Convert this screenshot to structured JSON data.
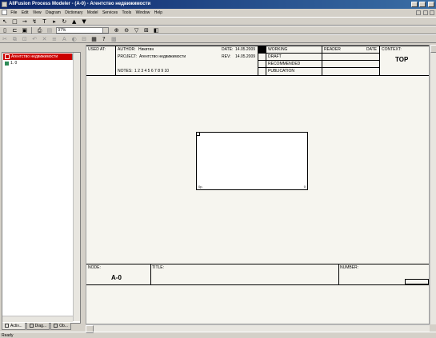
{
  "window": {
    "title": "AllFusion Process Modeler - (A-0) - Агентство недвижимости"
  },
  "menu": [
    "File",
    "Edit",
    "View",
    "Diagram",
    "Dictionary",
    "Model",
    "Services",
    "Tools",
    "Window",
    "Help"
  ],
  "toolbar": {
    "zoom_value": "97%"
  },
  "model_explorer": {
    "root_label": "Агентство недвижимости",
    "child_label": "1. 0",
    "tabs": [
      "Activ...",
      "Diag...",
      "Ob..."
    ]
  },
  "diagram": {
    "used_at_label": "USED AT:",
    "author_label": "AUTHOR:",
    "author_value": "Никитин",
    "date_label": "DATE:",
    "date_value": "14.05.2009",
    "project_label": "PROJECT:",
    "project_value": "Агентство недвижимости",
    "rev_label": "REV:",
    "rev_value": "14.05.2009",
    "notes_label": "NOTES:",
    "notes_value": "1  2  3  4  5  6  7  8  9  10",
    "status_rows": [
      "WORKING",
      "DRAFT",
      "RECOMMENDED",
      "PUBLICATION"
    ],
    "reader_label": "READER",
    "reader_date_label": "DATE",
    "context_label": "CONTEXT:",
    "context_value": "TOP",
    "box_cost": "0p.",
    "box_number": "0",
    "node_label": "NODE:",
    "node_value": "A-0",
    "title_label": "TITLE:",
    "number_label": "NUMBER:"
  },
  "status_bar": {
    "text": "Ready"
  }
}
